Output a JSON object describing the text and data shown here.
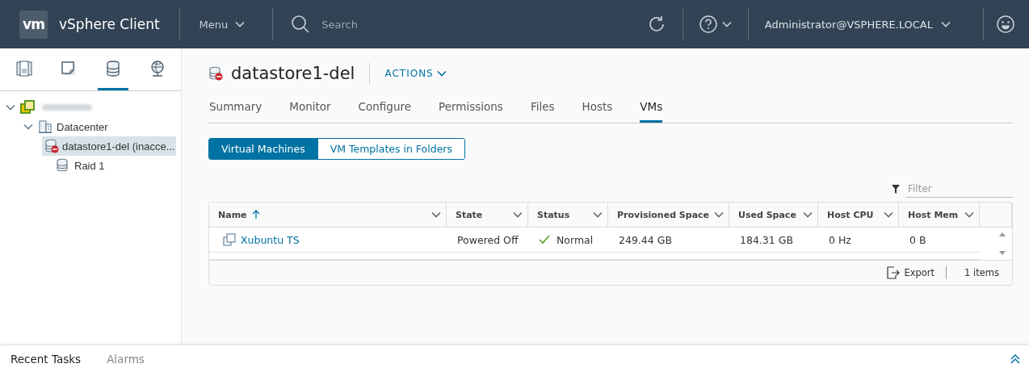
{
  "header": {
    "logo": "vm",
    "app_title": "vSphere Client",
    "menu": "Menu",
    "search_placeholder": "Search",
    "user": "Administrator@VSPHERE.LOCAL"
  },
  "sidebar": {
    "tabs": [
      {
        "kind": "hosts",
        "selected": false
      },
      {
        "kind": "vms",
        "selected": false
      },
      {
        "kind": "storage",
        "selected": true
      },
      {
        "kind": "network",
        "selected": false
      }
    ],
    "tree": [
      {
        "kind": "vcenter",
        "expanded": true,
        "selected": false,
        "children": [
          {
            "kind": "datacenter",
            "label": "Datacenter",
            "expanded": true,
            "selected": false,
            "children": [
              {
                "kind": "datastore-error",
                "label": "datastore1-del (inacce...",
                "selected": true
              },
              {
                "kind": "datastore",
                "label": "Raid 1",
                "selected": false
              }
            ]
          }
        ]
      }
    ]
  },
  "object": {
    "title": "datastore1-del",
    "actions": "ACTIONS",
    "tabs": [
      {
        "label": "Summary",
        "selected": false
      },
      {
        "label": "Monitor",
        "selected": false
      },
      {
        "label": "Configure",
        "selected": false
      },
      {
        "label": "Permissions",
        "selected": false
      },
      {
        "label": "Files",
        "selected": false
      },
      {
        "label": "Hosts",
        "selected": false
      },
      {
        "label": "VMs",
        "selected": true
      }
    ],
    "subtabs": [
      {
        "label": "Virtual Machines",
        "selected": true
      },
      {
        "label": "VM Templates in Folders",
        "selected": false
      }
    ],
    "filter_placeholder": "Filter",
    "table": {
      "columns": [
        {
          "label": "Name",
          "sorted": true
        },
        {
          "label": "State",
          "sorted": false
        },
        {
          "label": "Status",
          "sorted": false
        },
        {
          "label": "Provisioned Space",
          "sorted": false
        },
        {
          "label": "Used Space",
          "sorted": false
        },
        {
          "label": "Host CPU",
          "sorted": false
        },
        {
          "label": "Host Mem",
          "sorted": false
        }
      ],
      "rows": [
        {
          "name": "Xubuntu TS",
          "state": "Powered Off",
          "status": "Normal",
          "provisioned": "249.44 GB",
          "used": "184.31 GB",
          "host_cpu": "0 Hz",
          "host_mem": "0 B"
        }
      ],
      "export": "Export",
      "count": "1 items"
    }
  },
  "bottom": {
    "tabs": [
      {
        "label": "Recent Tasks",
        "selected": true
      },
      {
        "label": "Alarms",
        "selected": false
      }
    ]
  }
}
